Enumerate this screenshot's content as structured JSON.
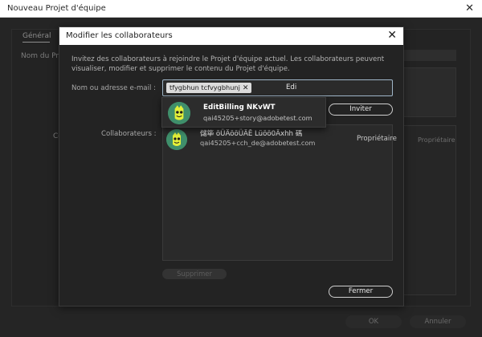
{
  "background_window": {
    "title": "Nouveau Projet d'équipe",
    "tab_general": "Général",
    "label_nom": "Nom du Pr",
    "label_c": "Co",
    "role_text": "Propriétaire",
    "ok_label": "OK",
    "cancel_label": "Annuler"
  },
  "dialog": {
    "title": "Modifier les collaborateurs",
    "intro": "Invitez des collaborateurs à rejoindre le Projet d'équipe actuel. Les collaborateurs peuvent visualiser, modifier et supprimer le contenu du Projet d'équipe.",
    "email_label": "Nom ou adresse e-mail :",
    "email_chip": "tfygbhun tcfvygbhunj",
    "email_typed": "Edi",
    "invite_label": "Inviter",
    "collaborators_label": "Collaborateurs :",
    "collaborators": [
      {
        "name": "儲筚 ōÜÄōōÜÄĒ Lüōō0Äxhh 碼",
        "email": "qai45205+cch_de@adobetest.com",
        "role": "Propriétaire"
      }
    ],
    "remove_label": "Supprimer",
    "close_label": "Fermer"
  },
  "suggestion": {
    "name": "EditBilling NKvWT",
    "email": "qai45205+story@adobetest.com"
  },
  "colors": {
    "accent_border": "#9fb6c8",
    "avatar_green": "#3f8f6b",
    "avatar_yellow": "#e3f03a"
  }
}
